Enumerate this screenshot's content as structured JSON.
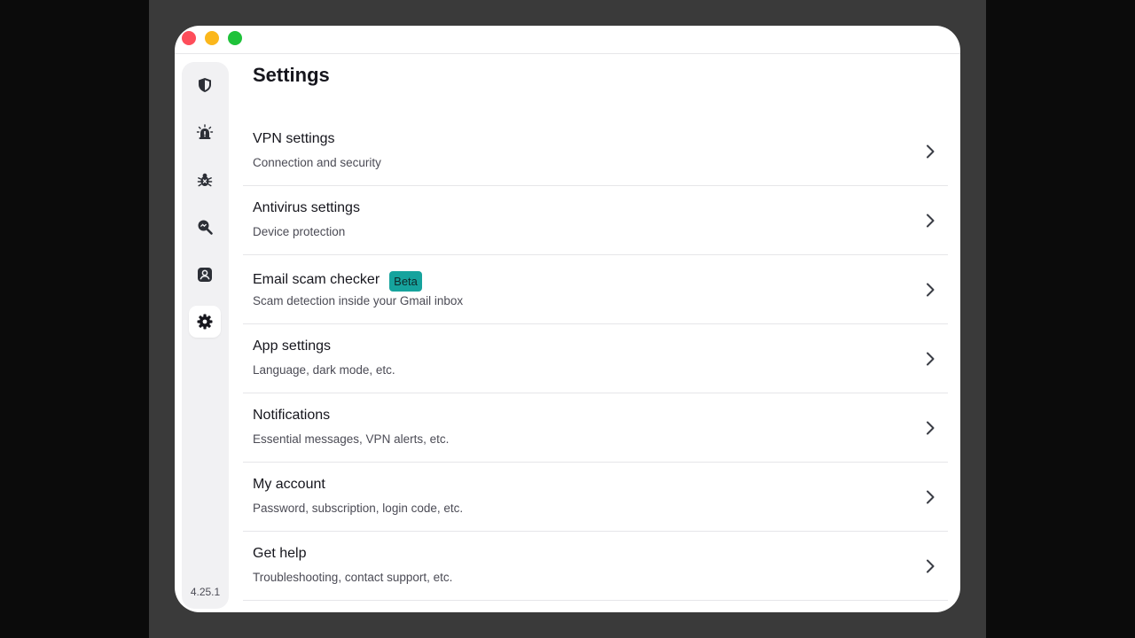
{
  "window": {
    "controls": [
      "close",
      "minimize",
      "maximize"
    ]
  },
  "sidebar": {
    "items": [
      {
        "icon": "shield-icon",
        "active": false
      },
      {
        "icon": "alarm-icon",
        "active": false
      },
      {
        "icon": "bug-icon",
        "active": false
      },
      {
        "icon": "search-scan-icon",
        "active": false
      },
      {
        "icon": "account-icon",
        "active": false
      },
      {
        "icon": "gear-icon",
        "active": true
      }
    ],
    "version": "4.25.1"
  },
  "main": {
    "title": "Settings",
    "rows": [
      {
        "title": "VPN settings",
        "subtitle": "Connection and security"
      },
      {
        "title": "Antivirus settings",
        "subtitle": "Device protection"
      },
      {
        "title": "Email scam checker",
        "badge": "Beta",
        "subtitle": "Scam detection inside your Gmail inbox"
      },
      {
        "title": "App settings",
        "subtitle": "Language, dark mode, etc."
      },
      {
        "title": "Notifications",
        "subtitle": "Essential messages, VPN alerts, etc."
      },
      {
        "title": "My account",
        "subtitle": "Password, subscription, login code, etc."
      },
      {
        "title": "Get help",
        "subtitle": "Troubleshooting, contact support, etc."
      }
    ]
  },
  "colors": {
    "accent_badge": "#16a39d",
    "close": "#fe4d5a",
    "minimize": "#fbb71c",
    "maximize": "#1fc23a"
  }
}
